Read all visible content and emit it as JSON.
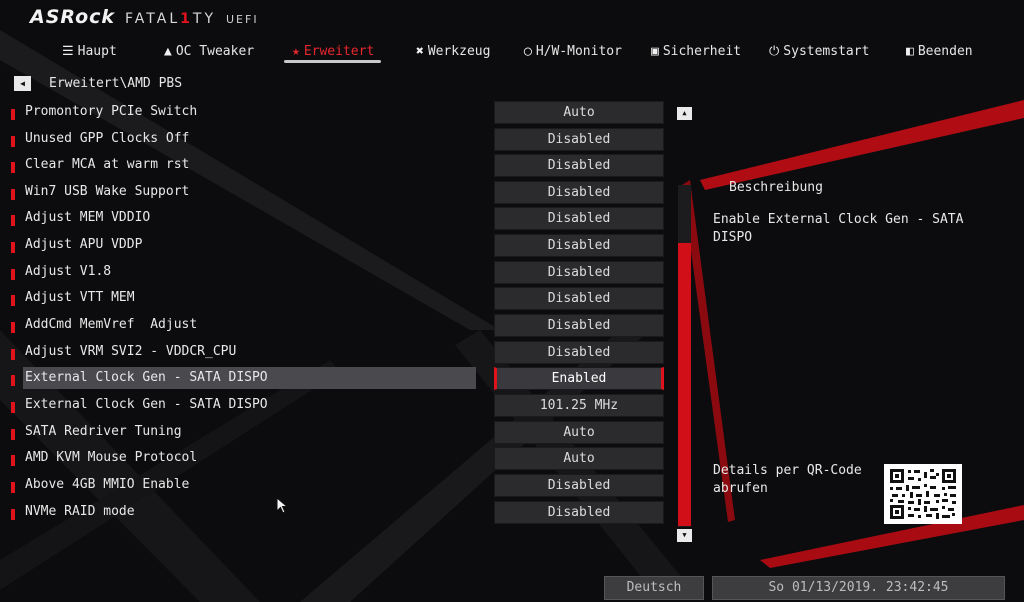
{
  "brand": {
    "maker": "ASRock",
    "series_pre": "FATAL",
    "series_mid": "1",
    "series_post": "TY",
    "uefi": "UEFI"
  },
  "nav": [
    {
      "label": "Haupt",
      "icon": "list-icon"
    },
    {
      "label": "OC Tweaker",
      "icon": "rocket-icon"
    },
    {
      "label": "Erweitert",
      "icon": "star-icon",
      "active": true
    },
    {
      "label": "Werkzeug",
      "icon": "tools-icon"
    },
    {
      "label": "H/W-Monitor",
      "icon": "monitor-icon"
    },
    {
      "label": "Sicherheit",
      "icon": "shield-icon"
    },
    {
      "label": "Systemstart",
      "icon": "power-icon"
    },
    {
      "label": "Beenden",
      "icon": "exit-icon"
    }
  ],
  "breadcrumb": "Erweitert\\AMD PBS",
  "settings": [
    {
      "label": "Promontory PCIe Switch",
      "value": "Auto"
    },
    {
      "label": "Unused GPP Clocks Off",
      "value": "Disabled"
    },
    {
      "label": "Clear MCA at warm rst",
      "value": "Disabled"
    },
    {
      "label": "Win7 USB Wake Support",
      "value": "Disabled"
    },
    {
      "label": "Adjust MEM VDDIO",
      "value": "Disabled"
    },
    {
      "label": "Adjust APU VDDP",
      "value": "Disabled"
    },
    {
      "label": "Adjust V1.8",
      "value": "Disabled"
    },
    {
      "label": "Adjust VTT MEM",
      "value": "Disabled"
    },
    {
      "label": "AddCmd MemVref  Adjust",
      "value": "Disabled"
    },
    {
      "label": "Adjust VRM SVI2 - VDDCR_CPU",
      "value": "Disabled"
    },
    {
      "label": "External Clock Gen - SATA DISPO",
      "value": "Enabled",
      "selected": true
    },
    {
      "label": "External Clock Gen - SATA DISPO",
      "value": "101.25 MHz"
    },
    {
      "label": "SATA Redriver Tuning",
      "value": "Auto"
    },
    {
      "label": "AMD KVM Mouse Protocol",
      "value": "Auto"
    },
    {
      "label": "Above 4GB MMIO Enable",
      "value": "Disabled"
    },
    {
      "label": "NVMe RAID mode",
      "value": "Disabled"
    }
  ],
  "description": {
    "title": "Beschreibung",
    "text": "Enable External Clock Gen - SATA DISPO"
  },
  "qr": {
    "text": "Details per QR-Code abrufen"
  },
  "footer": {
    "language": "Deutsch",
    "datetime": "So 01/13/2019. 23:42:45"
  },
  "colors": {
    "accent": "#e0121c",
    "background": "#0c0c0e",
    "value_box": "#2b2b2e"
  }
}
